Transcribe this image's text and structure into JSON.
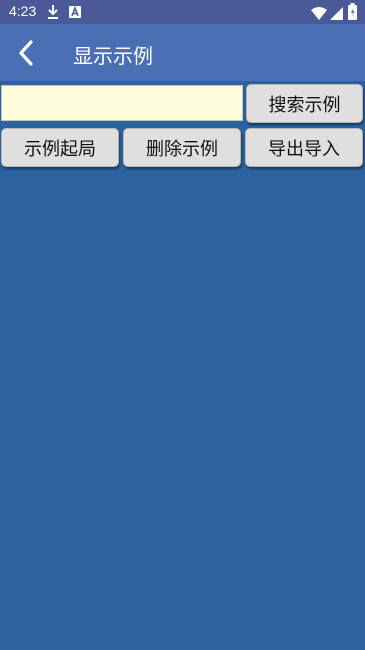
{
  "status_bar": {
    "time": "4:23",
    "icons": [
      "download-icon",
      "a-notification-icon",
      "wifi-icon",
      "cell-signal-icon",
      "battery-icon"
    ]
  },
  "app_bar": {
    "title": "显示示例",
    "back_icon": "chevron-left-icon"
  },
  "search": {
    "value": "",
    "placeholder": "",
    "button_label": "搜索示例"
  },
  "actions": {
    "example_start_label": "示例起局",
    "delete_label": "删除示例",
    "export_import_label": "导出导入"
  },
  "colors": {
    "background": "#2a63a0",
    "status_bar": "#4a5a98",
    "app_bar": "#4b6fb5",
    "input_background": "#fefedc",
    "button_background": "#dfdfdf"
  }
}
